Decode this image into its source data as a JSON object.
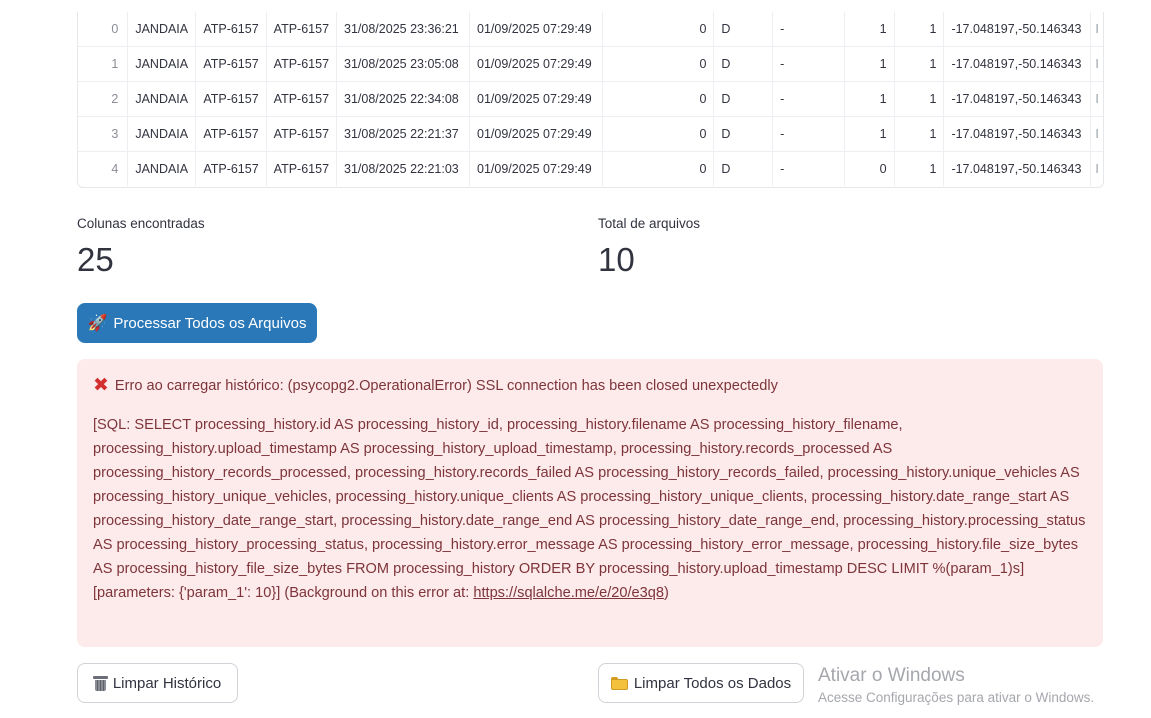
{
  "table": {
    "rows": [
      {
        "idx": "0",
        "city": "JANDAIA",
        "plate1": "ATP-6157",
        "plate2": "ATP-6157",
        "ts1": "31/08/2025 23:36:21",
        "ts2": "01/09/2025 07:29:49",
        "val": "0",
        "type": "D",
        "dash": "-",
        "a": "1",
        "b": "1",
        "coords": "-17.048197,-50.146343",
        "trail": "I"
      },
      {
        "idx": "1",
        "city": "JANDAIA",
        "plate1": "ATP-6157",
        "plate2": "ATP-6157",
        "ts1": "31/08/2025 23:05:08",
        "ts2": "01/09/2025 07:29:49",
        "val": "0",
        "type": "D",
        "dash": "-",
        "a": "1",
        "b": "1",
        "coords": "-17.048197,-50.146343",
        "trail": "I"
      },
      {
        "idx": "2",
        "city": "JANDAIA",
        "plate1": "ATP-6157",
        "plate2": "ATP-6157",
        "ts1": "31/08/2025 22:34:08",
        "ts2": "01/09/2025 07:29:49",
        "val": "0",
        "type": "D",
        "dash": "-",
        "a": "1",
        "b": "1",
        "coords": "-17.048197,-50.146343",
        "trail": "I"
      },
      {
        "idx": "3",
        "city": "JANDAIA",
        "plate1": "ATP-6157",
        "plate2": "ATP-6157",
        "ts1": "31/08/2025 22:21:37",
        "ts2": "01/09/2025 07:29:49",
        "val": "0",
        "type": "D",
        "dash": "-",
        "a": "1",
        "b": "1",
        "coords": "-17.048197,-50.146343",
        "trail": "I"
      },
      {
        "idx": "4",
        "city": "JANDAIA",
        "plate1": "ATP-6157",
        "plate2": "ATP-6157",
        "ts1": "31/08/2025 22:21:03",
        "ts2": "01/09/2025 07:29:49",
        "val": "0",
        "type": "D",
        "dash": "-",
        "a": "0",
        "b": "1",
        "coords": "-17.048197,-50.146343",
        "trail": "I"
      }
    ]
  },
  "metrics": {
    "columns_label": "Colunas encontradas",
    "columns_value": "25",
    "files_label": "Total de arquivos",
    "files_value": "10"
  },
  "process_button": {
    "icon": "rocket-icon",
    "label": "Processar Todos os Arquivos"
  },
  "error": {
    "icon": "cross-mark-icon",
    "accent_color": "#d32f2f",
    "title": "Erro ao carregar histórico: (psycopg2.OperationalError) SSL connection has been closed unexpectedly",
    "body": "[SQL: SELECT processing_history.id AS processing_history_id, processing_history.filename AS processing_history_filename, processing_history.upload_timestamp AS processing_history_upload_timestamp, processing_history.records_processed AS processing_history_records_processed, processing_history.records_failed AS processing_history_records_failed, processing_history.unique_vehicles AS processing_history_unique_vehicles, processing_history.unique_clients AS processing_history_unique_clients, processing_history.date_range_start AS processing_history_date_range_start, processing_history.date_range_end AS processing_history_date_range_end, processing_history.processing_status AS processing_history_processing_status, processing_history.error_message AS processing_history_error_message, processing_history.file_size_bytes AS processing_history_file_size_bytes FROM processing_history ORDER BY processing_history.upload_timestamp DESC LIMIT %(param_1)s] [parameters: {'param_1': 10}] (Background on this error at: ",
    "link_text": "https://sqlalche.me/e/20/e3q8",
    "closing": ")"
  },
  "actions": {
    "clear_history_label": "Limpar Histórico",
    "clear_history_icon": "trash-icon",
    "clear_all_label": "Limpar Todos os Dados",
    "clear_all_icon": "folder-icon"
  },
  "windows_watermark": {
    "title": "Ativar o Windows",
    "subtitle": "Acesse Configurações para ativar o Windows."
  },
  "colors": {
    "primary": "#2a78b8",
    "error_bg": "#fdeaea",
    "error_text": "#7d353b"
  }
}
